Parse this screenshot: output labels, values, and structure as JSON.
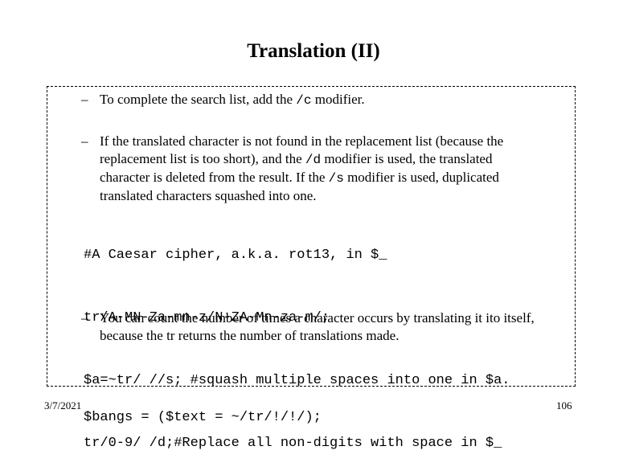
{
  "slide": {
    "title": "Translation (II)",
    "bullets": [
      {
        "dash": "–",
        "parts": [
          {
            "text": "To complete the search list, add the ",
            "mono": false
          },
          {
            "text": "/c",
            "mono": true
          },
          {
            "text": " modifier.",
            "mono": false
          }
        ]
      },
      {
        "dash": "–",
        "parts": [
          {
            "text": "If the translated character is not found in the replacement list (because the replacement list is too short), and the ",
            "mono": false
          },
          {
            "text": "/d",
            "mono": true
          },
          {
            "text": " modifier is used, the translated character is deleted from the result. If the ",
            "mono": false
          },
          {
            "text": "/s",
            "mono": true
          },
          {
            "text": " modifier is used, duplicated translated characters squashed into one.",
            "mono": false
          }
        ]
      },
      {
        "dash": "–",
        "parts": [
          {
            "text": "You can count the number of times a character occurs by translating it ito itself, because the tr returns the number of translations made.",
            "mono": false
          }
        ]
      }
    ],
    "code_block_1": [
      "#A Caesar cipher, a.k.a. rot13, in $_",
      "tr/A-MN-Za-mn-z/N-ZA-Mn-za-m/;",
      "$a=~tr/ //s; #squash multiple spaces into one in $a.",
      "tr/0-9/ /d;#Replace all non-digits with space in $_"
    ],
    "code_block_2": [
      "$bangs = ($text = ~/tr/!/!/);"
    ]
  },
  "footer": {
    "date": "3/7/2021",
    "page_number": "106"
  }
}
